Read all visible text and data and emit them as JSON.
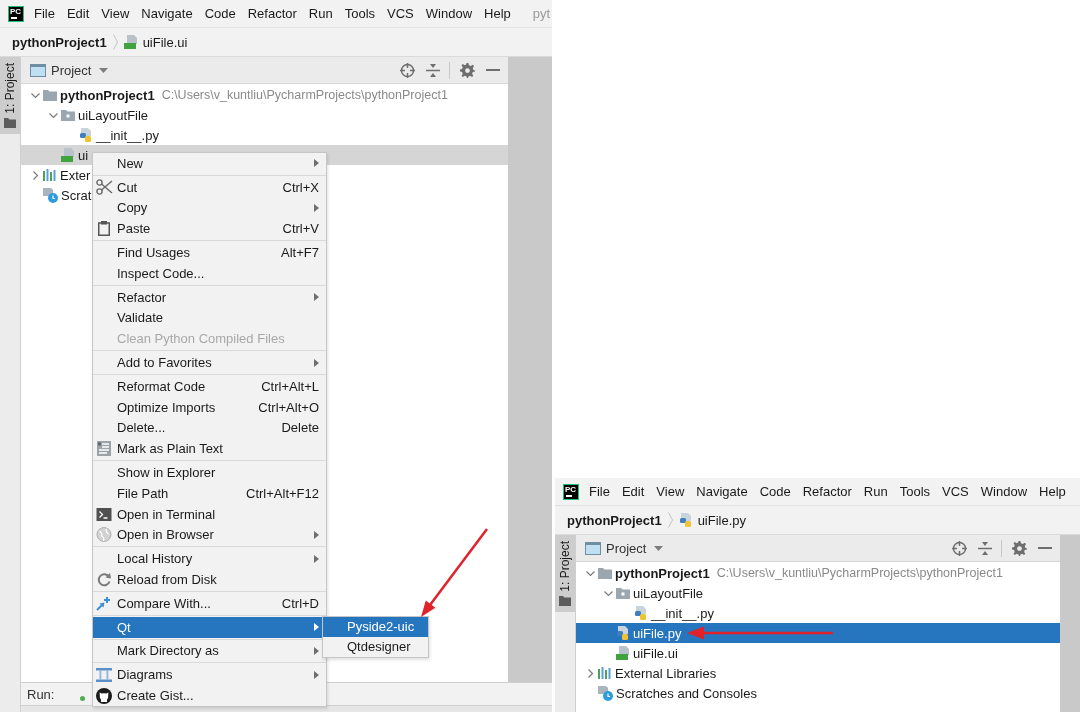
{
  "screenshots": [
    {
      "menu_bar": {
        "logo": "PC",
        "items": [
          "File",
          "Edit",
          "View",
          "Navigate",
          "Code",
          "Refactor",
          "Run",
          "Tools",
          "VCS",
          "Window",
          "Help"
        ],
        "title": "pyt"
      },
      "breadcrumb": [
        {
          "label": "pythonProject1",
          "kind": "root"
        },
        {
          "label": "uiFile.ui",
          "kind": "qt"
        }
      ],
      "side_tab": {
        "label": "1: Project",
        "selected": true
      },
      "project_panel": {
        "title": "Project",
        "focused": false,
        "tree": [
          {
            "label": "pythonProject1",
            "kind": "project",
            "path": "C:\\Users\\v_kuntliu\\PycharmProjects\\pythonProject1",
            "expanded": true,
            "selected": false,
            "children": [
              {
                "label": "uiLayoutFile",
                "kind": "package",
                "expanded": true,
                "selected": false,
                "children": [
                  {
                    "label": "__init__.py",
                    "kind": "python",
                    "selected": false
                  }
                ]
              },
              {
                "label": "ui",
                "kind": "qt",
                "selected": true
              }
            ]
          },
          {
            "label": "Exter",
            "kind": "libraries",
            "expanded": false,
            "selected": false
          },
          {
            "label": "Scrat",
            "kind": "scratches",
            "selected": false
          }
        ]
      },
      "context_menu": {
        "groups": [
          {
            "items": [
              {
                "label": "New",
                "kind": "plain",
                "has_submenu": true,
                "disabled": false,
                "selected": false
              }
            ]
          },
          {
            "items": [
              {
                "label": "Cut",
                "kind": "cut",
                "shortcut": "Ctrl+X",
                "has_submenu": false,
                "disabled": false,
                "selected": false
              },
              {
                "label": "Copy",
                "kind": "plain",
                "has_submenu": true,
                "disabled": false,
                "selected": false
              },
              {
                "label": "Paste",
                "kind": "paste",
                "shortcut": "Ctrl+V",
                "has_submenu": false,
                "disabled": false,
                "selected": false
              }
            ]
          },
          {
            "items": [
              {
                "label": "Find Usages",
                "kind": "plain",
                "shortcut": "Alt+F7",
                "has_submenu": false,
                "disabled": false,
                "selected": false
              },
              {
                "label": "Inspect Code...",
                "kind": "plain",
                "has_submenu": false,
                "disabled": false,
                "selected": false
              }
            ]
          },
          {
            "items": [
              {
                "label": "Refactor",
                "kind": "plain",
                "has_submenu": true,
                "disabled": false,
                "selected": false
              },
              {
                "label": "Validate",
                "kind": "plain",
                "has_submenu": false,
                "disabled": false,
                "selected": false
              },
              {
                "label": "Clean Python Compiled Files",
                "kind": "plain",
                "has_submenu": false,
                "disabled": true,
                "selected": false
              }
            ]
          },
          {
            "items": [
              {
                "label": "Add to Favorites",
                "kind": "plain",
                "has_submenu": true,
                "disabled": false,
                "selected": false
              }
            ]
          },
          {
            "items": [
              {
                "label": "Reformat Code",
                "kind": "plain",
                "shortcut": "Ctrl+Alt+L",
                "has_submenu": false,
                "disabled": false,
                "selected": false
              },
              {
                "label": "Optimize Imports",
                "kind": "plain",
                "shortcut": "Ctrl+Alt+O",
                "has_submenu": false,
                "disabled": false,
                "selected": false
              },
              {
                "label": "Delete...",
                "kind": "plain",
                "shortcut": "Delete",
                "has_submenu": false,
                "disabled": false,
                "selected": false
              },
              {
                "label": "Mark as Plain Text",
                "kind": "text",
                "has_submenu": false,
                "disabled": false,
                "selected": false
              }
            ]
          },
          {
            "items": [
              {
                "label": "Show in Explorer",
                "kind": "plain",
                "has_submenu": false,
                "disabled": false,
                "selected": false
              },
              {
                "label": "File Path",
                "kind": "plain",
                "shortcut": "Ctrl+Alt+F12",
                "has_submenu": false,
                "disabled": false,
                "selected": false
              },
              {
                "label": "Open in Terminal",
                "kind": "terminal",
                "has_submenu": false,
                "disabled": false,
                "selected": false
              },
              {
                "label": "Open in Browser",
                "kind": "browser",
                "has_submenu": true,
                "disabled": false,
                "selected": false
              }
            ]
          },
          {
            "items": [
              {
                "label": "Local History",
                "kind": "plain",
                "has_submenu": true,
                "disabled": false,
                "selected": false
              },
              {
                "label": "Reload from Disk",
                "kind": "reload",
                "has_submenu": false,
                "disabled": false,
                "selected": false
              }
            ]
          },
          {
            "items": [
              {
                "label": "Compare With...",
                "kind": "compare",
                "shortcut": "Ctrl+D",
                "has_submenu": false,
                "disabled": false,
                "selected": false
              }
            ]
          },
          {
            "items": [
              {
                "label": "Qt",
                "kind": "plain",
                "has_submenu": true,
                "disabled": false,
                "selected": true,
                "submenu_items": [
                  {
                    "label": "Pyside2-uic",
                    "selected": true,
                    "pointer_arrow": true
                  },
                  {
                    "label": "Qtdesigner",
                    "selected": false,
                    "pointer_arrow": false
                  }
                ]
              }
            ]
          },
          {
            "items": [
              {
                "label": "Mark Directory as",
                "kind": "plain",
                "has_submenu": true,
                "disabled": false,
                "selected": false
              }
            ]
          },
          {
            "items": [
              {
                "label": "Diagrams",
                "kind": "diagrams",
                "has_submenu": true,
                "disabled": false,
                "selected": false
              },
              {
                "label": "Create Gist...",
                "kind": "gist",
                "has_submenu": false,
                "disabled": false,
                "selected": false
              }
            ]
          }
        ]
      },
      "run_bar": {
        "label": "Run:"
      }
    },
    {
      "menu_bar": {
        "logo": "PC",
        "items": [
          "File",
          "Edit",
          "View",
          "Navigate",
          "Code",
          "Refactor",
          "Run",
          "Tools",
          "VCS",
          "Window",
          "Help"
        ]
      },
      "breadcrumb": [
        {
          "label": "pythonProject1",
          "kind": "root"
        },
        {
          "label": "uiFile.py",
          "kind": "python"
        }
      ],
      "side_tab": {
        "label": "1: Project",
        "selected": true
      },
      "project_panel": {
        "title": "Project",
        "focused": true,
        "tree": [
          {
            "label": "pythonProject1",
            "kind": "project",
            "path": "C:\\Users\\v_kuntliu\\PycharmProjects\\pythonProject1",
            "expanded": true,
            "selected": false,
            "children": [
              {
                "label": "uiLayoutFile",
                "kind": "package",
                "expanded": true,
                "selected": false,
                "pointer_arrow": false,
                "children": [
                  {
                    "label": "__init__.py",
                    "kind": "python",
                    "selected": false
                  }
                ]
              },
              {
                "label": "uiFile.py",
                "kind": "python",
                "selected": true,
                "pointer_arrow": true
              },
              {
                "label": "uiFile.ui",
                "kind": "qt",
                "selected": false,
                "pointer_arrow": false
              }
            ]
          },
          {
            "label": "External Libraries",
            "kind": "libraries",
            "expanded": false,
            "selected": false
          },
          {
            "label": "Scratches and Consoles",
            "kind": "scratches",
            "selected": false
          }
        ]
      }
    }
  ]
}
